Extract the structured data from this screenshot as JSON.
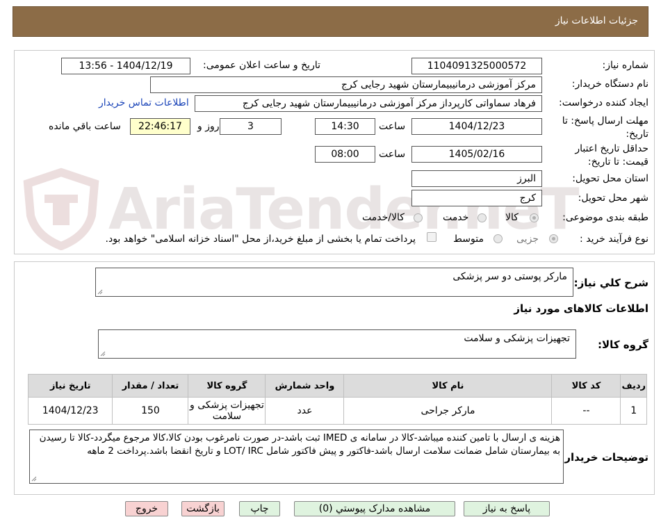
{
  "header": {
    "title": "جزئیات اطلاعات نیاز"
  },
  "watermark": {
    "text": "AriaTender.neT"
  },
  "form": {
    "need_number_label": "شماره نیاز:",
    "need_number": "1104091325000572",
    "announce_label": "تاریخ و ساعت اعلان عمومی:",
    "announce_value": "1404/12/19 - 13:56",
    "buyer_label": "نام دستگاه خریدار:",
    "buyer_value": "مرکز آموزشی درمانیبیمارستان شهید رجایی کرج",
    "creator_label": "ایجاد کننده درخواست:",
    "creator_value": "فرهاد سماواتی کارپرداز مرکز آموزشی درمانیبیمارستان شهید رجایی کرج",
    "contact_link": "اطلاعات تماس خریدار",
    "deadline_label": "مهلت ارسال پاسخ: تا تاریخ:",
    "deadline_date": "1404/12/23",
    "time_label": "ساعت",
    "deadline_time": "14:30",
    "days_value": "3",
    "days_label": "روز و",
    "remaining_time": "22:46:17",
    "remaining_label": "ساعت باقي مانده",
    "validity_label": "حداقل تاریخ اعتبار قیمت: تا تاریخ:",
    "validity_date": "1405/02/16",
    "validity_time": "08:00",
    "province_label": "استان محل تحویل:",
    "province_value": "البرز",
    "city_label": "شهر محل تحویل:",
    "city_value": "کرج",
    "category_label": "طبقه بندی موضوعی:",
    "category_options": [
      "کالا",
      "خدمت",
      "کالا/خدمت"
    ],
    "category_selected": "کالا",
    "process_label": "نوع فرآیند خرید :",
    "process_options": [
      "جزیی",
      "متوسط"
    ],
    "process_selected": "جزیی",
    "payment_note": "پرداخت تمام یا بخشی از مبلغ خرید،از محل \"اسناد خزانه اسلامی\" خواهد بود."
  },
  "details": {
    "summary_label": "شرح کلي نياز:",
    "summary_value": "مارکر پوستی دو سر پزشکی",
    "goods_info_title": "اطلاعات کالاهای مورد نیاز",
    "goods_group_label": "گروه کالا:",
    "goods_group_value": "تجهیزات پزشکی و سلامت",
    "table": {
      "headers": [
        "رديف",
        "کد کالا",
        "نام کالا",
        "واحد شمارش",
        "گروه کالا",
        "تعداد / مقدار",
        "تاریخ نیاز"
      ],
      "rows": [
        [
          "1",
          "--",
          "مارکر جراحی",
          "عدد",
          "تجهیزات پزشکی و سلامت",
          "150",
          "1404/12/23"
        ]
      ]
    },
    "buyer_notes_label": "توضیحات خریدار:",
    "buyer_notes_value": "هزینه ی ارسال با تامین کننده میباشد-کالا در سامانه ی IMED ثبت باشد-در صورت نامرغوب بودن کالا،کالا مرجوع میگردد-کالا تا رسیدن به بیمارستان شامل ضمانت سلامت ارسال باشد-فاکتور و پیش فاکتور شامل LOT/ IRC و تاریخ انقضا باشد.پرداخت 2 ماهه"
  },
  "buttons": {
    "reply": "پاسخ به نیاز",
    "view_docs": "مشاهده مدارک پیوستي (0)",
    "print": "چاپ",
    "back": "بازگشت",
    "exit": "خروج"
  }
}
